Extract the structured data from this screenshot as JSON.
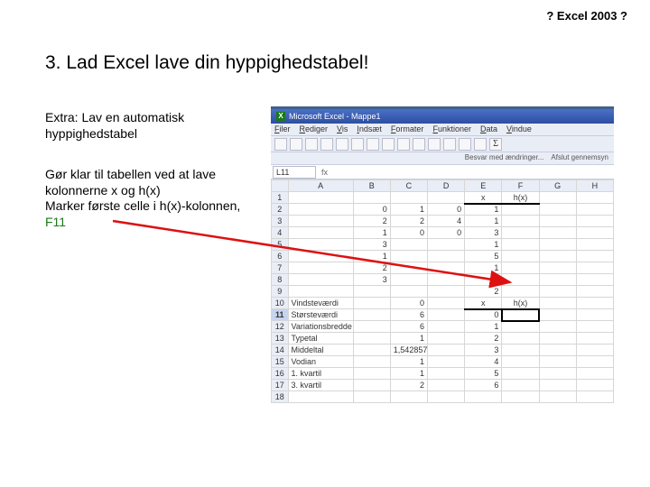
{
  "header": "? Excel 2003 ?",
  "title": "3. Lad Excel lave din hyppighedstabel!",
  "subtitle": "Extra: Lav en automatisk hyppighedstabel",
  "body1": "Gør klar til tabellen ved at lave kolonnerne x og h(x)",
  "body2a": "Marker første celle i h(x)-kolonnen, ",
  "body2b": "F11",
  "win": {
    "title": "Microsoft Excel - Mappe1",
    "menus": [
      "Filer",
      "Rediger",
      "Vis",
      "Indsæt",
      "Formater",
      "Funktioner",
      "Data",
      "Vindue"
    ],
    "info1": "Besvar med ændringer...",
    "info2": "Afslut gennemsyn",
    "namebox": "L11",
    "fx": "fx"
  },
  "cols": [
    "",
    "A",
    "B",
    "C",
    "D",
    "E",
    "F",
    "G",
    "H"
  ],
  "rowhdr": {
    "E1": "x",
    "F1": "h(x)"
  },
  "rows": [
    {
      "n": "1",
      "A": "",
      "B": "",
      "C": "",
      "D": "",
      "E": "x",
      "F": "h(x)",
      "G": "",
      "H": "",
      "hdr": true
    },
    {
      "n": "2",
      "A": "",
      "B": "0",
      "C": "1",
      "D": "0",
      "E": "1",
      "F": "",
      "G": "",
      "H": ""
    },
    {
      "n": "3",
      "A": "",
      "B": "2",
      "C": "2",
      "D": "4",
      "E": "1",
      "F": "",
      "G": "",
      "H": ""
    },
    {
      "n": "4",
      "A": "",
      "B": "1",
      "C": "0",
      "D": "0",
      "E": "3",
      "F": "",
      "G": "",
      "H": ""
    },
    {
      "n": "5",
      "A": "",
      "B": "3",
      "C": "",
      "D": "",
      "E": "1",
      "F": "",
      "G": "",
      "H": ""
    },
    {
      "n": "6",
      "A": "",
      "B": "1",
      "C": "",
      "D": "",
      "E": "5",
      "F": "",
      "G": "",
      "H": ""
    },
    {
      "n": "7",
      "A": "",
      "B": "2",
      "C": "",
      "D": "",
      "E": "1",
      "F": "",
      "G": "",
      "H": ""
    },
    {
      "n": "8",
      "A": "",
      "B": "3",
      "C": "",
      "D": "",
      "E": "1",
      "F": "",
      "G": "",
      "H": ""
    },
    {
      "n": "9",
      "A": "",
      "B": "",
      "C": "",
      "D": "",
      "E": "2",
      "F": "",
      "G": "",
      "H": ""
    },
    {
      "n": "10",
      "A": "Vindsteværdi",
      "B": "",
      "C": "0",
      "D": "",
      "E": "x",
      "F": "h(x)",
      "G": "",
      "H": "",
      "hdr2": true
    },
    {
      "n": "11",
      "A": "Størsteværdi",
      "B": "",
      "C": "6",
      "D": "",
      "E": "0",
      "F": "",
      "G": "",
      "H": "",
      "sel": true
    },
    {
      "n": "12",
      "A": "Variationsbredde",
      "B": "",
      "C": "6",
      "D": "",
      "E": "1",
      "F": "",
      "G": "",
      "H": ""
    },
    {
      "n": "13",
      "A": "Typetal",
      "B": "",
      "C": "1",
      "D": "",
      "E": "2",
      "F": "",
      "G": "",
      "H": ""
    },
    {
      "n": "14",
      "A": "Middeltal",
      "B": "",
      "C": "1,542857",
      "D": "",
      "E": "3",
      "F": "",
      "G": "",
      "H": ""
    },
    {
      "n": "15",
      "A": "Vodian",
      "B": "",
      "C": "1",
      "D": "",
      "E": "4",
      "F": "",
      "G": "",
      "H": ""
    },
    {
      "n": "16",
      "A": "1. kvartil",
      "B": "",
      "C": "1",
      "D": "",
      "E": "5",
      "F": "",
      "G": "",
      "H": ""
    },
    {
      "n": "17",
      "A": "3. kvartil",
      "B": "",
      "C": "2",
      "D": "",
      "E": "6",
      "F": "",
      "G": "",
      "H": ""
    },
    {
      "n": "18",
      "A": "",
      "B": "",
      "C": "",
      "D": "",
      "E": "",
      "F": "",
      "G": "",
      "H": ""
    }
  ]
}
